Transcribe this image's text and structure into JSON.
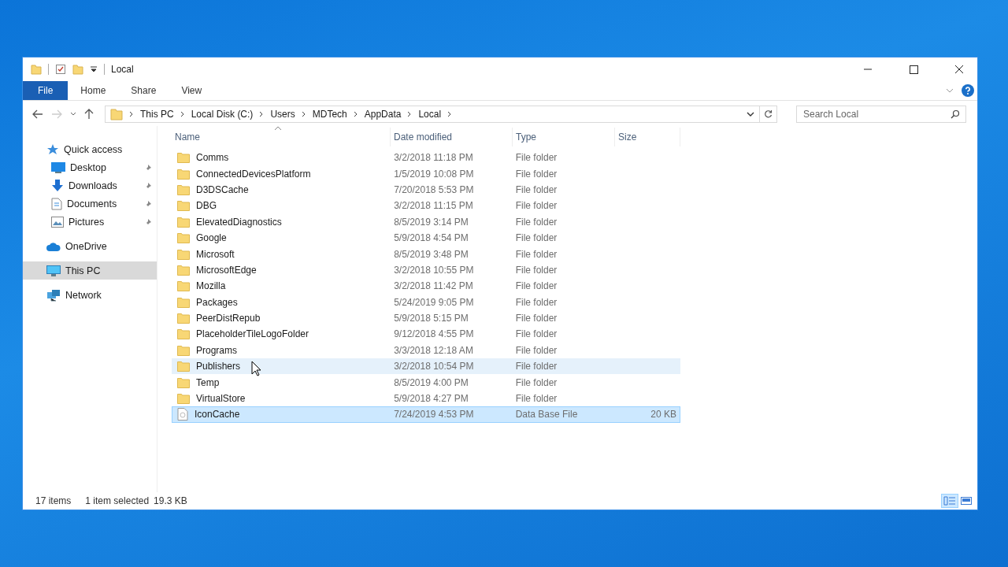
{
  "window": {
    "title": "Local"
  },
  "ribbon_tabs": [
    {
      "label": "File",
      "selected": true
    },
    {
      "label": "Home",
      "selected": false
    },
    {
      "label": "Share",
      "selected": false
    },
    {
      "label": "View",
      "selected": false
    }
  ],
  "breadcrumb": [
    "This PC",
    "Local Disk (C:)",
    "Users",
    "MDTech",
    "AppData",
    "Local"
  ],
  "search": {
    "placeholder": "Search Local"
  },
  "sidebar": {
    "items": [
      {
        "label": "Quick access",
        "kind": "star",
        "pinned": false,
        "selected": false
      },
      {
        "label": "Desktop",
        "kind": "desktop",
        "pinned": true,
        "selected": false
      },
      {
        "label": "Downloads",
        "kind": "download",
        "pinned": true,
        "selected": false
      },
      {
        "label": "Documents",
        "kind": "document",
        "pinned": true,
        "selected": false
      },
      {
        "label": "Pictures",
        "kind": "picture",
        "pinned": true,
        "selected": false
      },
      {
        "label": "OneDrive",
        "kind": "cloud",
        "pinned": false,
        "selected": false
      },
      {
        "label": "This PC",
        "kind": "pc",
        "pinned": false,
        "selected": true
      },
      {
        "label": "Network",
        "kind": "network",
        "pinned": false,
        "selected": false
      }
    ]
  },
  "table": {
    "columns": [
      "Name",
      "Date modified",
      "Type",
      "Size"
    ],
    "rows": [
      {
        "kind": "folder",
        "name": "Comms",
        "date": "3/2/2018 11:18 PM",
        "type": "File folder",
        "selected": false,
        "hovered": false
      },
      {
        "kind": "folder",
        "name": "ConnectedDevicesPlatform",
        "date": "1/5/2019 10:08 PM",
        "type": "File folder",
        "selected": false,
        "hovered": false
      },
      {
        "kind": "folder",
        "name": "D3DSCache",
        "date": "7/20/2018 5:53 PM",
        "type": "File folder",
        "selected": false,
        "hovered": false
      },
      {
        "kind": "folder",
        "name": "DBG",
        "date": "3/2/2018 11:15 PM",
        "type": "File folder",
        "selected": false,
        "hovered": false
      },
      {
        "kind": "folder",
        "name": "ElevatedDiagnostics",
        "date": "8/5/2019 3:14 PM",
        "type": "File folder",
        "selected": false,
        "hovered": false
      },
      {
        "kind": "folder",
        "name": "Google",
        "date": "5/9/2018 4:54 PM",
        "type": "File folder",
        "selected": false,
        "hovered": false
      },
      {
        "kind": "folder",
        "name": "Microsoft",
        "date": "8/5/2019 3:48 PM",
        "type": "File folder",
        "selected": false,
        "hovered": false
      },
      {
        "kind": "folder",
        "name": "MicrosoftEdge",
        "date": "3/2/2018 10:55 PM",
        "type": "File folder",
        "selected": false,
        "hovered": false
      },
      {
        "kind": "folder",
        "name": "Mozilla",
        "date": "3/2/2018 11:42 PM",
        "type": "File folder",
        "selected": false,
        "hovered": false
      },
      {
        "kind": "folder",
        "name": "Packages",
        "date": "5/24/2019 9:05 PM",
        "type": "File folder",
        "selected": false,
        "hovered": false
      },
      {
        "kind": "folder",
        "name": "PeerDistRepub",
        "date": "5/9/2018 5:15 PM",
        "type": "File folder",
        "selected": false,
        "hovered": false
      },
      {
        "kind": "folder",
        "name": "PlaceholderTileLogoFolder",
        "date": "9/12/2018 4:55 PM",
        "type": "File folder",
        "selected": false,
        "hovered": false
      },
      {
        "kind": "folder",
        "name": "Programs",
        "date": "3/3/2018 12:18 AM",
        "type": "File folder",
        "selected": false,
        "hovered": false
      },
      {
        "kind": "folder",
        "name": "Publishers",
        "date": "3/2/2018 10:54 PM",
        "type": "File folder",
        "selected": false,
        "hovered": true
      },
      {
        "kind": "folder",
        "name": "Temp",
        "date": "8/5/2019 4:00 PM",
        "type": "File folder",
        "selected": false,
        "hovered": false
      },
      {
        "kind": "folder",
        "name": "VirtualStore",
        "date": "5/9/2018 4:27 PM",
        "type": "File folder",
        "selected": false,
        "hovered": false
      },
      {
        "kind": "file",
        "name": "IconCache",
        "date": "7/24/2019 4:53 PM",
        "type": "Data Base File",
        "size": "20 KB",
        "selected": true,
        "hovered": false
      }
    ]
  },
  "status_bar": {
    "count": "17 items",
    "selection": "1 item selected",
    "size": "19.3 KB"
  }
}
